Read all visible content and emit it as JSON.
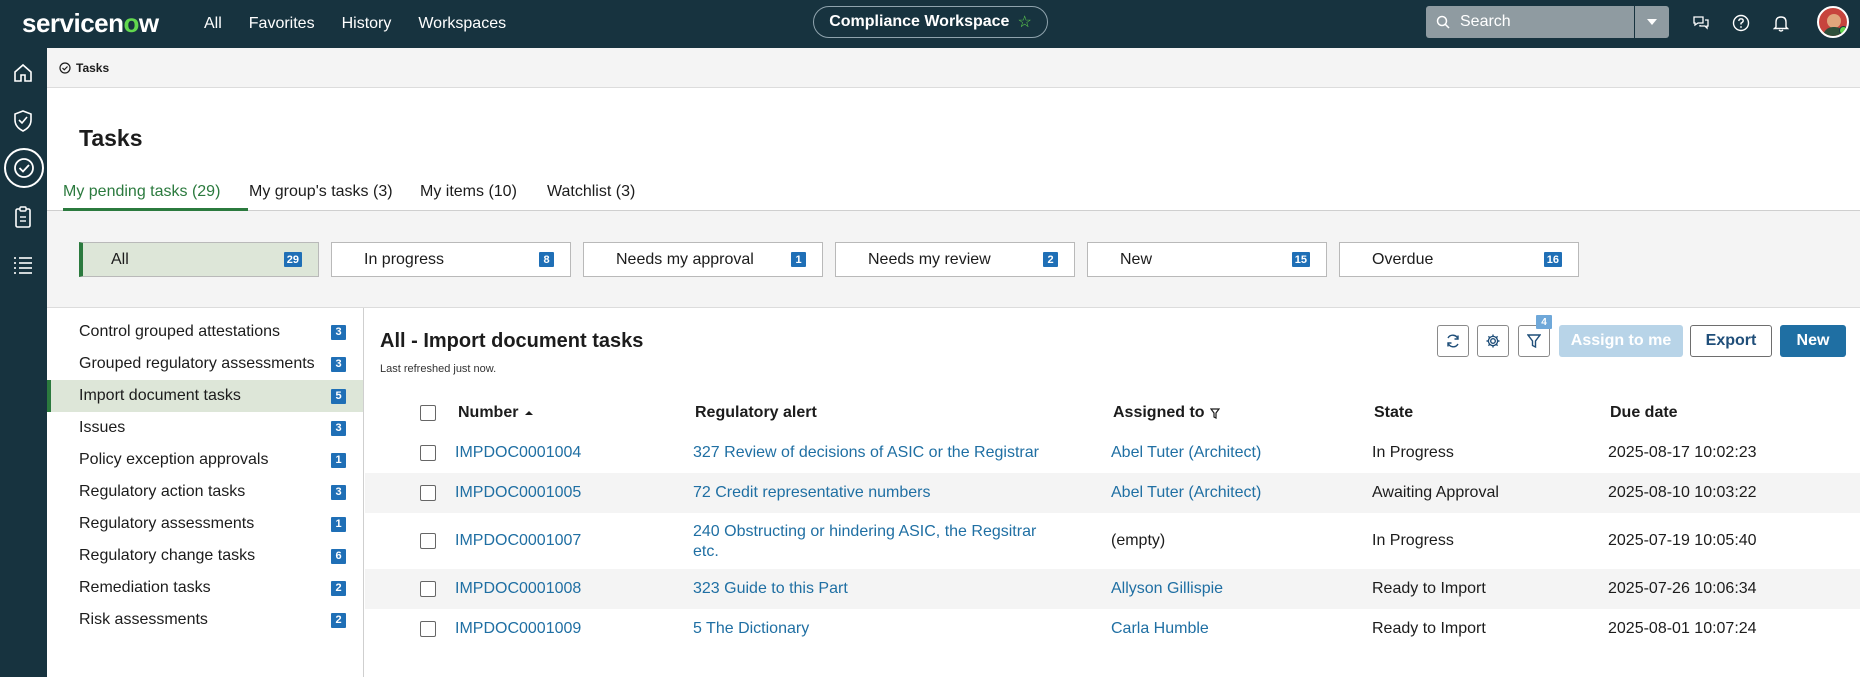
{
  "header": {
    "logo_main": "servicen",
    "logo_o": "o",
    "logo_end": "w",
    "nav": [
      "All",
      "Favorites",
      "History",
      "Workspaces"
    ],
    "workspace": "Compliance Workspace",
    "search_placeholder": "Search"
  },
  "breadcrumb": "Tasks",
  "page_title": "Tasks",
  "tabs": [
    {
      "label": "My pending tasks (29)"
    },
    {
      "label": "My group's tasks (3)"
    },
    {
      "label": "My items (10)"
    },
    {
      "label": "Watchlist (3)"
    }
  ],
  "filters": [
    {
      "label": "All",
      "count": "29"
    },
    {
      "label": "In progress",
      "count": "8"
    },
    {
      "label": "Needs my approval",
      "count": "1"
    },
    {
      "label": "Needs my review",
      "count": "2"
    },
    {
      "label": "New",
      "count": "15"
    },
    {
      "label": "Overdue",
      "count": "16"
    }
  ],
  "sidelist": [
    {
      "label": "Control grouped attestations",
      "count": "3"
    },
    {
      "label": "Grouped regulatory assessments",
      "count": "3"
    },
    {
      "label": "Import document tasks",
      "count": "5"
    },
    {
      "label": "Issues",
      "count": "3"
    },
    {
      "label": "Policy exception approvals",
      "count": "1"
    },
    {
      "label": "Regulatory action tasks",
      "count": "3"
    },
    {
      "label": "Regulatory assessments",
      "count": "1"
    },
    {
      "label": "Regulatory change tasks",
      "count": "6"
    },
    {
      "label": "Remediation tasks",
      "count": "2"
    },
    {
      "label": "Risk assessments",
      "count": "2"
    }
  ],
  "list": {
    "title": "All - Import document tasks",
    "subtitle": "Last refreshed just now.",
    "filter_count": "4",
    "assign_label": "Assign to me",
    "export_label": "Export",
    "new_label": "New",
    "columns": {
      "number": "Number",
      "alert": "Regulatory alert",
      "assigned": "Assigned to",
      "state": "State",
      "due": "Due date"
    },
    "rows": [
      {
        "number": "IMPDOC0001004",
        "alert": "327 Review of decisions of ASIC or the Registrar",
        "alert2": "",
        "assigned": "Abel Tuter (Architect)",
        "state": "In Progress",
        "due": "2025-08-17 10:02:23"
      },
      {
        "number": "IMPDOC0001005",
        "alert": "72 Credit representative numbers",
        "alert2": "",
        "assigned": "Abel Tuter (Architect)",
        "state": "Awaiting Approval",
        "due": "2025-08-10 10:03:22"
      },
      {
        "number": "IMPDOC0001007",
        "alert": "240 Obstructing or hindering ASIC, the Regsitrar",
        "alert2": "etc.",
        "assigned": "(empty)",
        "state": "In Progress",
        "due": "2025-07-19 10:05:40"
      },
      {
        "number": "IMPDOC0001008",
        "alert": "323 Guide to this Part",
        "alert2": "",
        "assigned": "Allyson Gillispie",
        "state": "Ready to Import",
        "due": "2025-07-26 10:06:34"
      },
      {
        "number": "IMPDOC0001009",
        "alert": "5 The Dictionary",
        "alert2": "",
        "assigned": "Carla Humble",
        "state": "Ready to Import",
        "due": "2025-08-01 10:07:24"
      }
    ]
  }
}
